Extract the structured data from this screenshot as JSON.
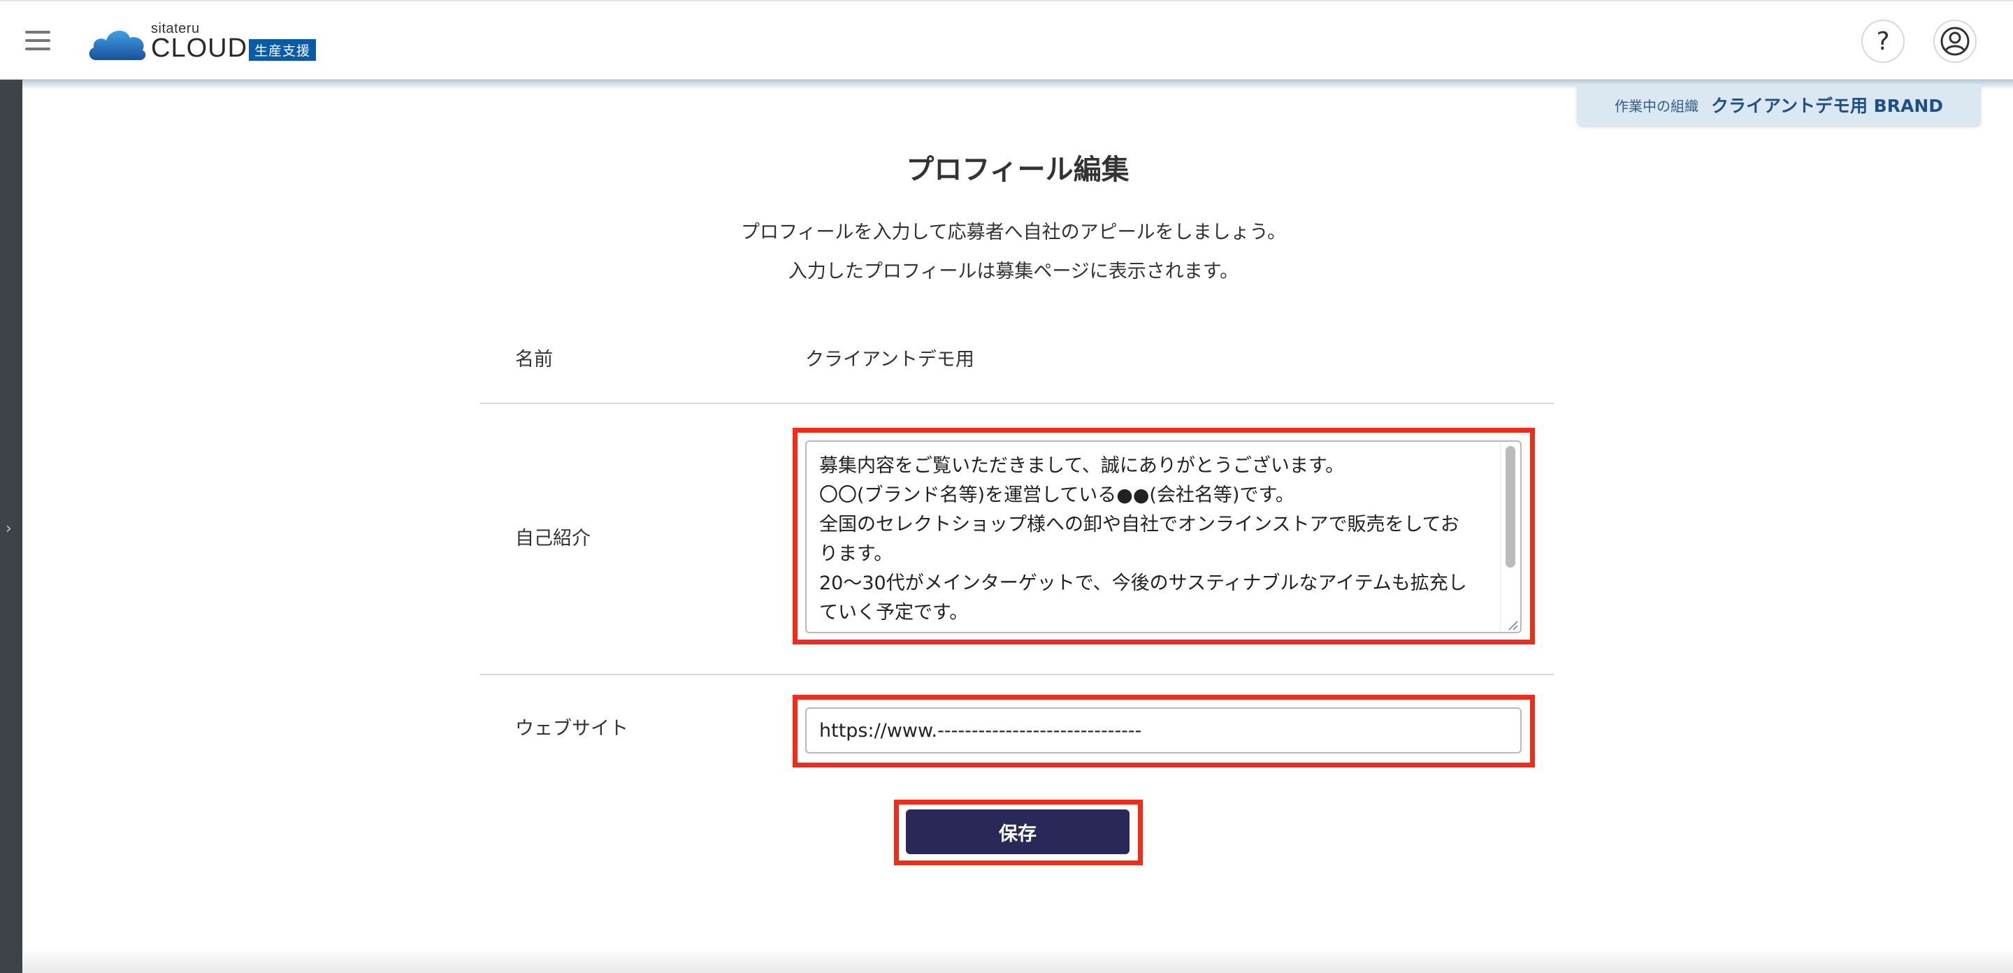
{
  "header": {
    "logo_small": "sitateru",
    "logo_big": "CLOUD",
    "logo_tag": "生産支援",
    "help_label": "?",
    "icons": {
      "menu": "hamburger-icon",
      "help": "question-icon",
      "user": "user-circle-icon"
    }
  },
  "org": {
    "label": "作業中の組織",
    "name": "クライアントデモ用 BRAND"
  },
  "page": {
    "title": "プロフィール編集",
    "description_line1": "プロフィールを入力して応募者へ自社のアピールをしましょう。",
    "description_line2": "入力したプロフィールは募集ページに表示されます。"
  },
  "form": {
    "name_label": "名前",
    "name_value": "クライアントデモ用",
    "intro_label": "自己紹介",
    "intro_lines": [
      "募集内容をご覧いただきまして、誠にありがとうございます。",
      "〇〇(ブランド名等)を運営している●●(会社名等)です。",
      "全国のセレクトショップ様への卸や自社でオンラインストアで販売をしてお",
      "ります。",
      "20〜30代がメインターゲットで、今後のサスティナブルなアイテムも拡充し",
      "ていく予定です。"
    ],
    "website_label": "ウェブサイト",
    "website_value": "https://www.------------------------------",
    "save_label": "保存"
  },
  "colors": {
    "highlight": "#ee2d1a",
    "save_button": "#2a2858",
    "org_badge": "#dbe7f1",
    "logo_tag": "#0b5aa6",
    "rail": "#3d4349"
  }
}
